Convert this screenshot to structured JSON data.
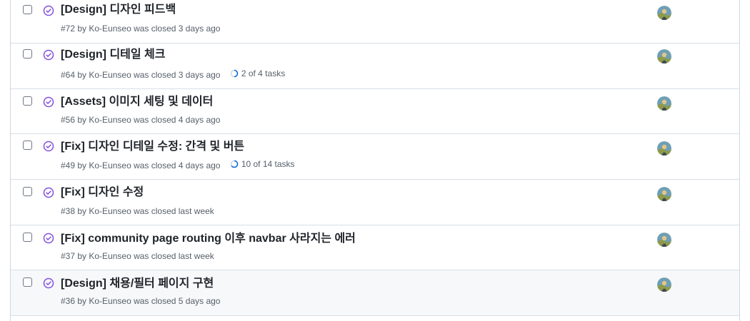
{
  "issues": [
    {
      "title": "[Design] 디자인 피드백",
      "meta": "#72 by Ko-Eunseo was closed 3 days ago",
      "tasks": ""
    },
    {
      "title": "[Design] 디테일 체크",
      "meta": "#64 by Ko-Eunseo was closed 3 days ago",
      "tasks": "2 of 4 tasks",
      "tasks_done": 2,
      "tasks_total": 4
    },
    {
      "title": "[Assets] 이미지 세팅 및 데이터",
      "meta": "#56 by Ko-Eunseo was closed 4 days ago",
      "tasks": ""
    },
    {
      "title": "[Fix] 디자인 디테일 수정: 간격 및 버튼",
      "meta": "#49 by Ko-Eunseo was closed 4 days ago",
      "tasks": "10 of 14 tasks",
      "tasks_done": 10,
      "tasks_total": 14
    },
    {
      "title": "[Fix] 디자인 수정",
      "meta": "#38 by Ko-Eunseo was closed last week",
      "tasks": ""
    },
    {
      "title": "[Fix] community page routing 이후 navbar 사라지는 에러",
      "meta": "#37 by Ko-Eunseo was closed last week",
      "tasks": ""
    },
    {
      "title": "[Design] 채용/필터 페이지 구현",
      "meta": "#36 by Ko-Eunseo was closed 5 days ago",
      "tasks": ""
    }
  ],
  "colors": {
    "closed_icon": "#8250df",
    "progress": "#0969da",
    "border": "#d0d7de"
  },
  "icons": {
    "state": "closed-issue-check-circle-icon",
    "tasks": "task-progress-ring-icon",
    "avatar": "user-avatar"
  }
}
